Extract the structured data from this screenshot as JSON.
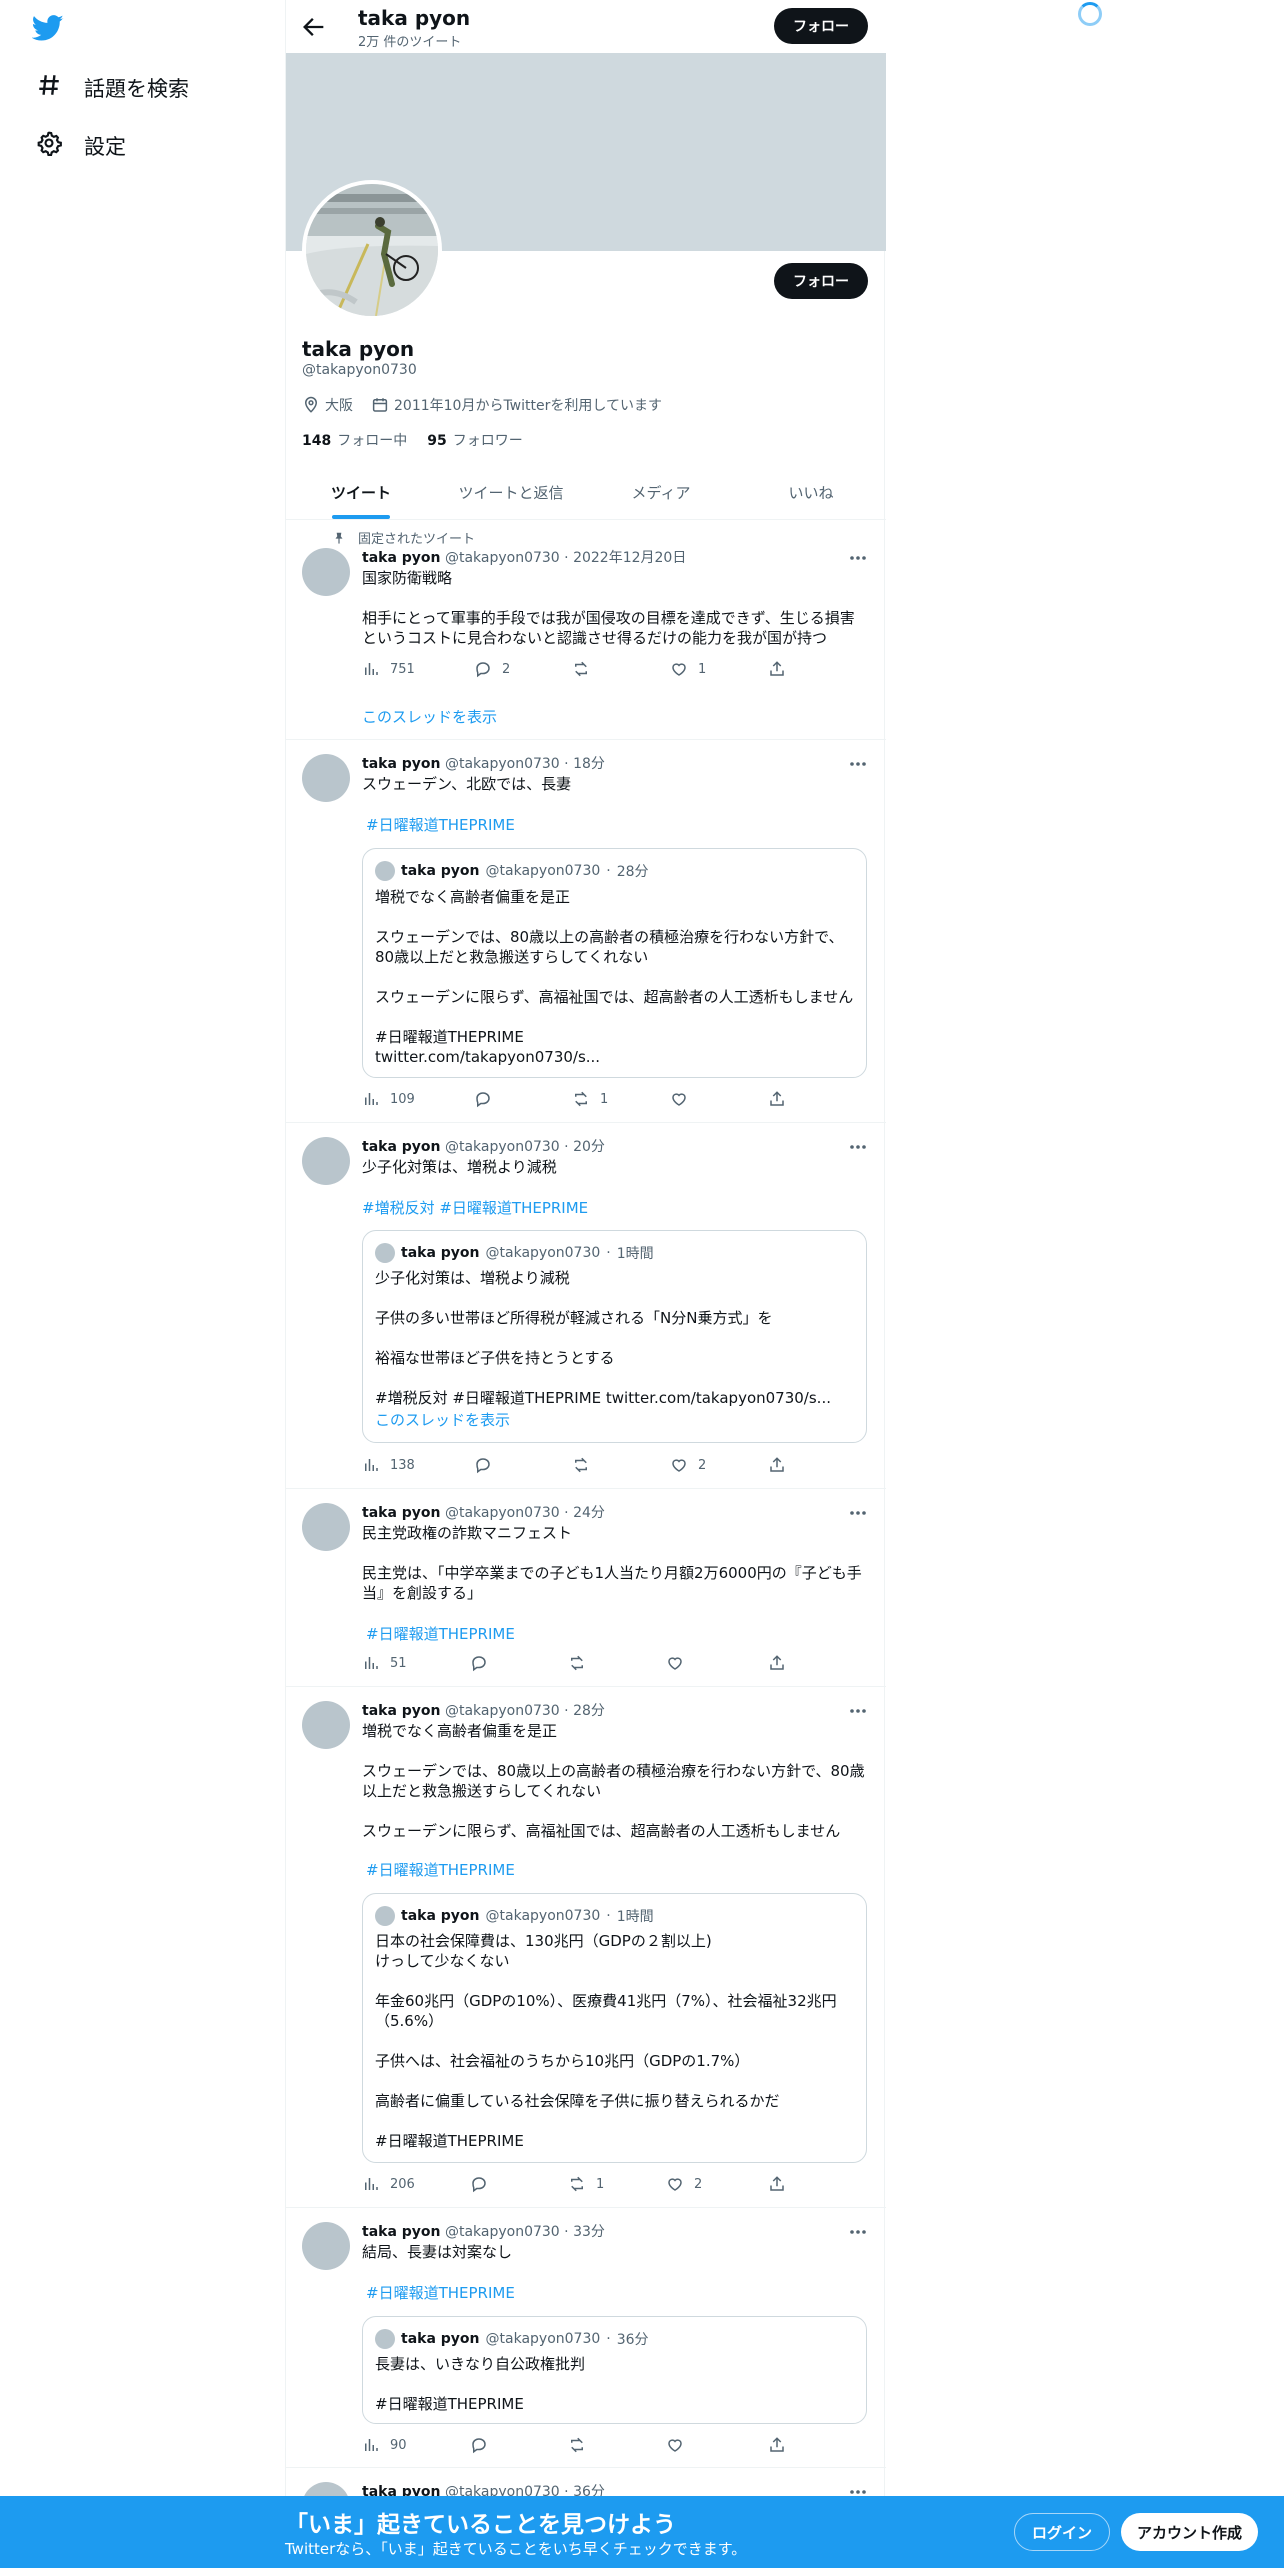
{
  "nav": {
    "logo_icon": "twitter-bird-icon",
    "explore": "話題を検索",
    "settings": "設定"
  },
  "header": {
    "name": "taka pyon",
    "tweet_count": "2万 件のツイート",
    "follow": "フォロー"
  },
  "profile": {
    "name": "taka pyon",
    "handle": "@takapyon0730",
    "location": "大阪",
    "joined": "2011年10月からTwitterを利用しています",
    "following_count": "148",
    "following_label": "フォロー中",
    "followers_count": "95",
    "followers_label": "フォロワー",
    "follow": "フォロー"
  },
  "tabs": [
    "ツイート",
    "ツイートと返信",
    "メディア",
    "いいね"
  ],
  "tweets": [
    {
      "pinned_label": "固定されたツイート",
      "name": "taka pyon",
      "handle": "@takapyon0730",
      "time": "2022年12月20日",
      "text": "国家防衛戦略\n\n相手にとって軍事的手段では我が国侵攻の目標を達成できず、生じる損害\nというコストに見合わないと認識させ得るだけの能力を我が国が持つ",
      "views": "751",
      "replies": "2",
      "retweets": "",
      "likes": "1",
      "thread_link": "このスレッドを表示"
    },
    {
      "name": "taka pyon",
      "handle": "@takapyon0730",
      "time": "18分",
      "text": "スウェーデン、北欧では、長妻",
      "hashtags": "#日曜報道THEPRIME",
      "quote": {
        "name": "taka pyon",
        "handle": "@takapyon0730",
        "time": "28分",
        "text": "増税でなく高齢者偏重を是正\n\nスウェーデンでは、80歳以上の高齢者の積極治療を行わない方針で、\n80歳以上だと救急搬送すらしてくれない\n\nスウェーデンに限らず、高福祉国では、超高齢者の人工透析もしません\n\n #日曜報道THEPRIME\ntwitter.com/takapyon0730/s..."
      },
      "views": "109",
      "replies": "",
      "retweets": "1",
      "likes": ""
    },
    {
      "name": "taka pyon",
      "handle": "@takapyon0730",
      "time": "20分",
      "text": "少子化対策は、増税より減税",
      "hashtags": "#増税反対 #日曜報道THEPRIME",
      "quote": {
        "name": "taka pyon",
        "handle": "@takapyon0730",
        "time": "1時間",
        "text": "少子化対策は、増税より減税\n\n子供の多い世帯ほど所得税が軽減される「N分N乗方式」を\n\n裕福な世帯ほど子供を持とうとする\n\n#増税反対 #日曜報道THEPRIME twitter.com/takapyon0730/s...",
        "link": "このスレッドを表示"
      },
      "views": "138",
      "replies": "",
      "retweets": "",
      "likes": "2"
    },
    {
      "name": "taka pyon",
      "handle": "@takapyon0730",
      "time": "24分",
      "text": "民主党政権の詐欺マニフェスト\n\n民主党は、「中学卒業までの子ども1人当たり月額2万6000円の『子ども手\n当』を創設する」",
      "hashtags": "#日曜報道THEPRIME",
      "views": "51",
      "replies": "",
      "retweets": "",
      "likes": ""
    },
    {
      "name": "taka pyon",
      "handle": "@takapyon0730",
      "time": "28分",
      "text": "増税でなく高齢者偏重を是正\n\nスウェーデンでは、80歳以上の高齢者の積極治療を行わない方針で、80歳\n以上だと救急搬送すらしてくれない\n\nスウェーデンに限らず、高福祉国では、超高齢者の人工透析もしません",
      "hashtags": "#日曜報道THEPRIME",
      "quote": {
        "name": "taka pyon",
        "handle": "@takapyon0730",
        "time": "1時間",
        "text": "日本の社会保障費は、130兆円（GDPの２割以上)\nけっして少なくない\n\n年金60兆円（GDPの10%）、医療費41兆円（7%）、社会福祉32兆円\n（5.6%）\n\n子供へは、社会福祉のうちから10兆円（GDPの1.7%）\n\n高齢者に偏重している社会保障を子供に振り替えられるかだ\n\n #日曜報道THEPRIME"
      },
      "views": "206",
      "replies": "",
      "retweets": "1",
      "likes": "2"
    },
    {
      "name": "taka pyon",
      "handle": "@takapyon0730",
      "time": "33分",
      "text": "結局、長妻は対案なし",
      "hashtags": "#日曜報道THEPRIME",
      "quote": {
        "name": "taka pyon",
        "handle": "@takapyon0730",
        "time": "36分",
        "text": "長妻は、いきなり自公政権批判\n\n #日曜報道THEPRIME"
      },
      "views": "90",
      "replies": "",
      "retweets": "",
      "likes": ""
    },
    {
      "name": "taka pyon",
      "handle": "@takapyon0730",
      "time": "36分"
    }
  ],
  "bottom_bar": {
    "title": "「いま」起きていることを見つけよう",
    "subtitle": "Twitterなら、「いま」起きていることをいち早くチェックできます。",
    "login": "ログイン",
    "signup": "アカウント作成"
  },
  "colors": {
    "accent": "#1d9bf0",
    "banner": "#cfd9de",
    "text": "#0f1419",
    "muted": "#536471"
  }
}
